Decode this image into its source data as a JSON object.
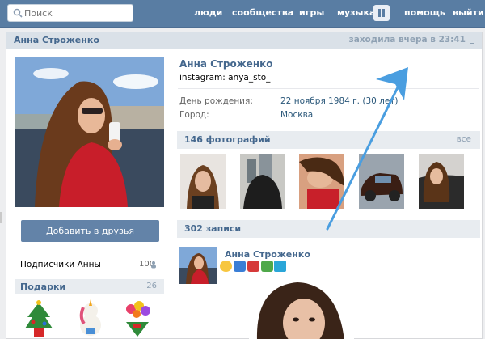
{
  "topbar": {
    "search_placeholder": "Поиск",
    "nav": [
      "люди",
      "сообщества",
      "игры",
      "музыка",
      "помощь",
      "выйти"
    ]
  },
  "header": {
    "name": "Анна Строженко",
    "status": "заходила вчера в 23:41"
  },
  "profile": {
    "name": "Анна Строженко",
    "status_text": "instagram: anya_sto_",
    "info": [
      {
        "label": "День рождения:",
        "value": "22 ноября 1984 г. (30 лет)"
      },
      {
        "label": "Город:",
        "value": "Москва"
      }
    ]
  },
  "left": {
    "add_friend": "Добавить в друзья",
    "subscribers_label": "Подписчики Анны",
    "subscribers_count": "100",
    "gifts_label": "Подарки",
    "gifts_count": "26"
  },
  "photos": {
    "title": "146 фотографий",
    "all": "все"
  },
  "wall": {
    "title": "302 записи",
    "post_author": "Анна Строженко"
  },
  "colors": {
    "topbar": "#597da3",
    "link": "#45688e",
    "arrow": "#4a9ee0"
  }
}
